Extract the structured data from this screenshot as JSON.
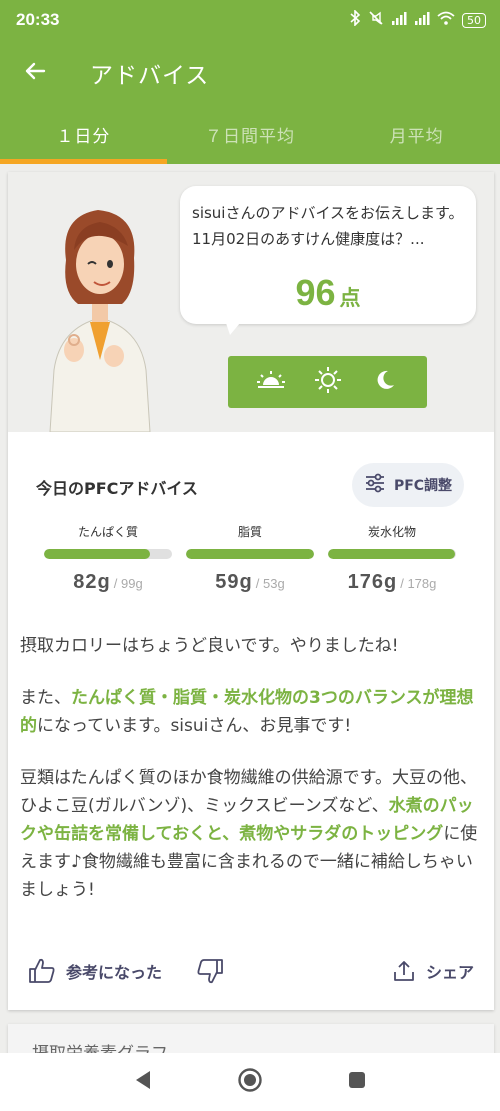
{
  "status_bar": {
    "time": "20:33",
    "battery": "50",
    "icons": [
      "bluetooth-icon",
      "mute-icon",
      "signal-icon",
      "signal-icon",
      "wifi-icon",
      "battery-icon"
    ]
  },
  "app_bar": {
    "title": "アドバイス",
    "back_icon": "arrow-left-icon"
  },
  "tabs": [
    {
      "label": "１日分",
      "active": true
    },
    {
      "label": "７日間平均",
      "active": false
    },
    {
      "label": "月平均",
      "active": false
    }
  ],
  "advice": {
    "bubble_text": "sisuiさんのアドバイスをお伝えします。11月02日のあすけん健康度は？...",
    "score": "96",
    "score_unit": "点",
    "time_buttons": [
      "sunrise-icon",
      "sun-icon",
      "moon-icon"
    ]
  },
  "pfc": {
    "title": "今日のPFCアドバイス",
    "adjust_label": "PFC調整",
    "nutrients": [
      {
        "label": "たんぱく質",
        "value": "82",
        "unit": "g",
        "target": "/ 99g",
        "fill": 0.83
      },
      {
        "label": "脂質",
        "value": "59",
        "unit": "g",
        "target": "/ 53g",
        "fill": 1.0
      },
      {
        "label": "炭水化物",
        "value": "176",
        "unit": "g",
        "target": "/ 178g",
        "fill": 0.99
      }
    ]
  },
  "paragraphs": {
    "p1": "摂取カロリーはちょうど良いです。やりましたね!",
    "p2_a": "また、",
    "p2_hl": "たんぱく質・脂質・炭水化物の3つのバランスが理想的",
    "p2_b": "になっています。sisuiさん、お見事です!",
    "p3_a": "豆類はたんぱく質のほか食物繊維の供給源です。大豆の他、ひよこ豆(ガルバンゾ)、ミックスビーンズなど、",
    "p3_hl": "水煮のパックや缶詰を常備しておくと、煮物やサラダのトッピング",
    "p3_b": "に使えます♪食物繊維も豊富に含まれるので一緒に補給しちゃいましょう!"
  },
  "actions": {
    "helpful_label": "参考になった",
    "share_label": "シェア"
  },
  "next_card": {
    "title": "摂取栄養素グラフ"
  },
  "colors": {
    "brand_green": "#7cb342",
    "tab_indicator": "#f5a623"
  }
}
